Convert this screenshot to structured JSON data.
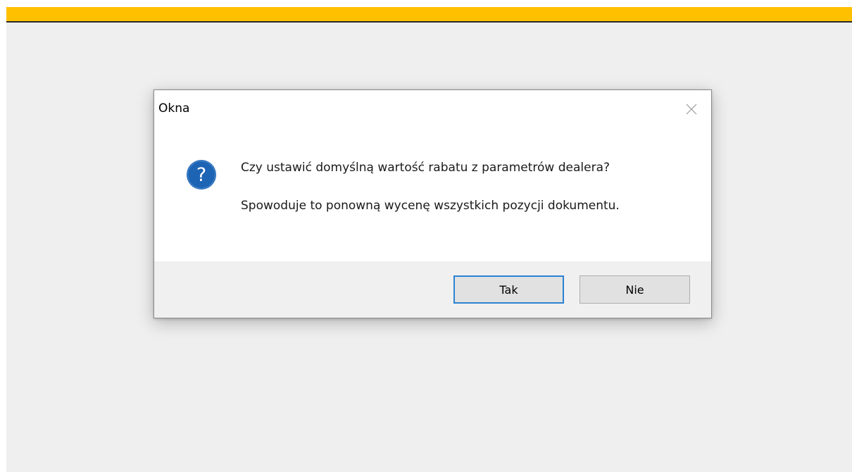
{
  "dialog": {
    "title": "Okna",
    "close_icon": "close-icon",
    "icon": "question-icon",
    "message": "Czy ustawić domyślną wartość rabatu z parametrów dealera?",
    "detail": "Spowoduje to ponowną wycenę wszystkich pozycji dokumentu.",
    "buttons": {
      "yes_label": "Tak",
      "no_label": "Nie"
    }
  },
  "colors": {
    "top_bar": "#ffc000",
    "icon_blue": "#1e64b4",
    "default_button_border": "#2c82d2",
    "background": "#efefef"
  }
}
